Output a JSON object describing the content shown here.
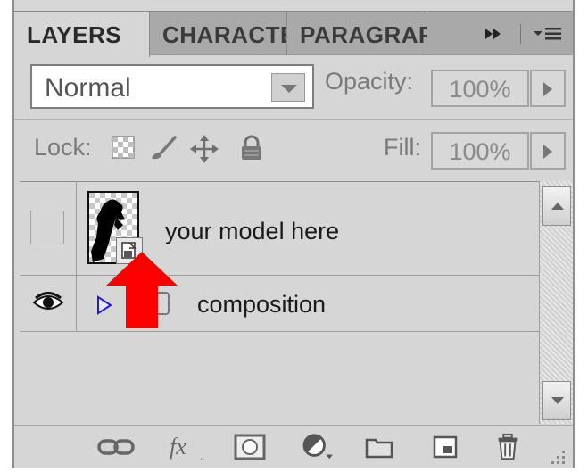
{
  "tabs": [
    {
      "label": "LAYERS",
      "active": true
    },
    {
      "label": "CHARACTER",
      "active": false
    },
    {
      "label": "PARAGRAPH",
      "active": false
    }
  ],
  "tab_controls": {
    "collapse_icon": "double-chevron-right-icon",
    "menu_icon": "panel-menu-icon"
  },
  "blend_mode": {
    "value": "Normal"
  },
  "opacity": {
    "label": "Opacity:",
    "value": "100%"
  },
  "lock": {
    "label": "Lock:",
    "icons": [
      "lock-transparent-pixels-icon",
      "lock-image-pixels-icon",
      "lock-position-icon",
      "lock-all-icon"
    ]
  },
  "fill": {
    "label": "Fill:",
    "value": "100%"
  },
  "layers": [
    {
      "name": "your model here",
      "visible": false,
      "type": "smart-object"
    },
    {
      "name": "composition",
      "visible": true,
      "type": "group",
      "expanded": false
    }
  ],
  "annotation": {
    "color": "#ff0000",
    "points_to": "smart-object-badge"
  },
  "footer_icons": [
    "link-layers-icon",
    "fx-icon",
    "add-mask-icon",
    "adjustment-layer-icon",
    "new-group-icon",
    "new-layer-icon",
    "trash-icon",
    "resize-grip-icon"
  ]
}
